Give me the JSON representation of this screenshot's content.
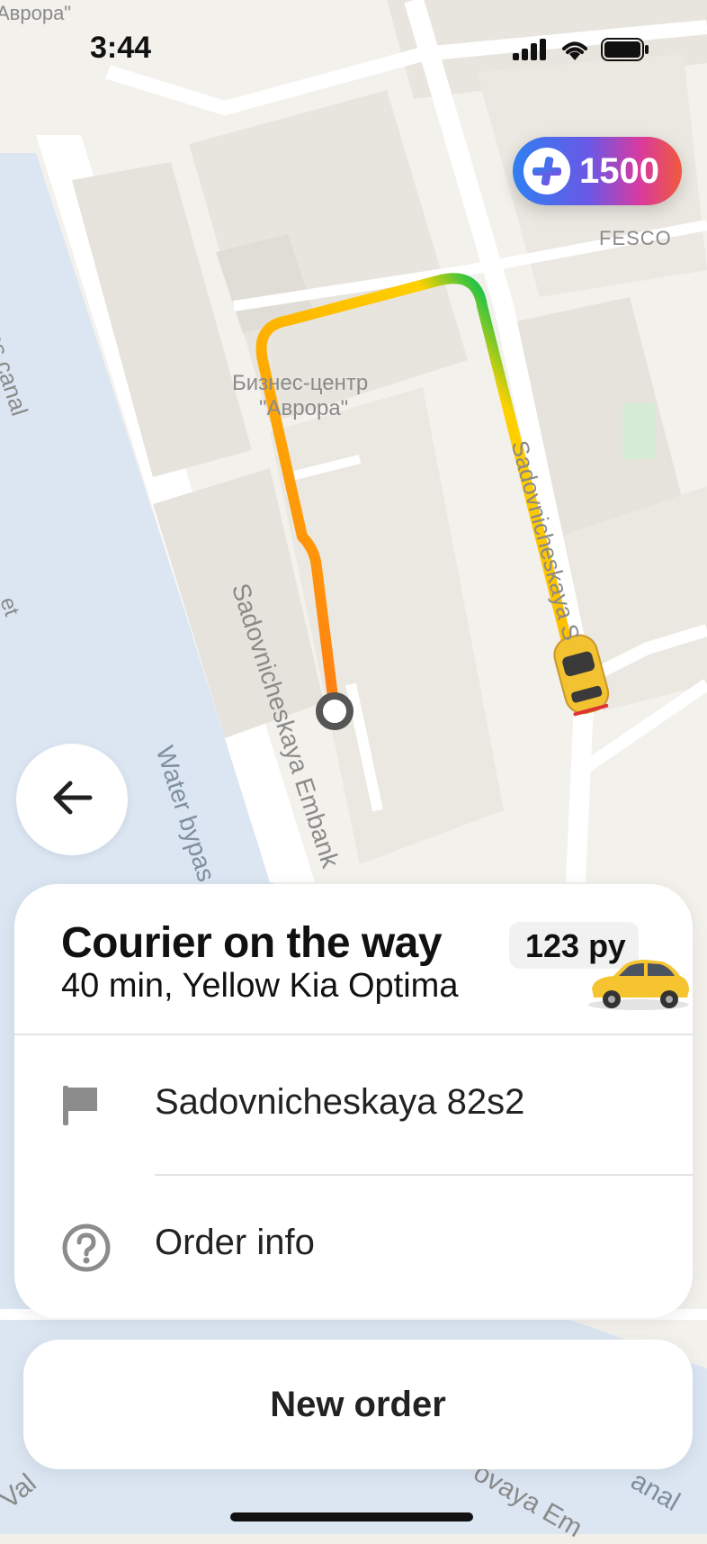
{
  "status_bar": {
    "time": "3:44"
  },
  "map": {
    "labels": {
      "top_left": "Аврора\"",
      "fesco": "FESCO",
      "business_center_line1": "Бизнес-центр",
      "business_center_line2": "\"Аврора\"",
      "canal": "ss canal",
      "street_left": "Sadovnicheskaya Embank",
      "street_right": "Sadovnicheskaya S",
      "water": "Water bypas",
      "bottom_left": "Val",
      "bottom_right": "ovaya Em",
      "bottom_right2": "anal",
      "left_edge": "et"
    },
    "route_colors": {
      "start": "#ff6a1a",
      "middle": "#ffb300",
      "end": "#17c24a"
    }
  },
  "plus_badge": {
    "value": "1500"
  },
  "order_card": {
    "title": "Courier on the way",
    "subtitle": "40 min, Yellow Kia Optima",
    "price": "123 ру",
    "destination": "Sadovnicheskaya 82s2",
    "info_label": "Order info"
  },
  "new_order_button": {
    "label": "New order"
  },
  "icons": {
    "back": "arrow-left-icon",
    "destination": "flag-icon",
    "info": "question-circle-icon",
    "plus": "plus-icon"
  }
}
